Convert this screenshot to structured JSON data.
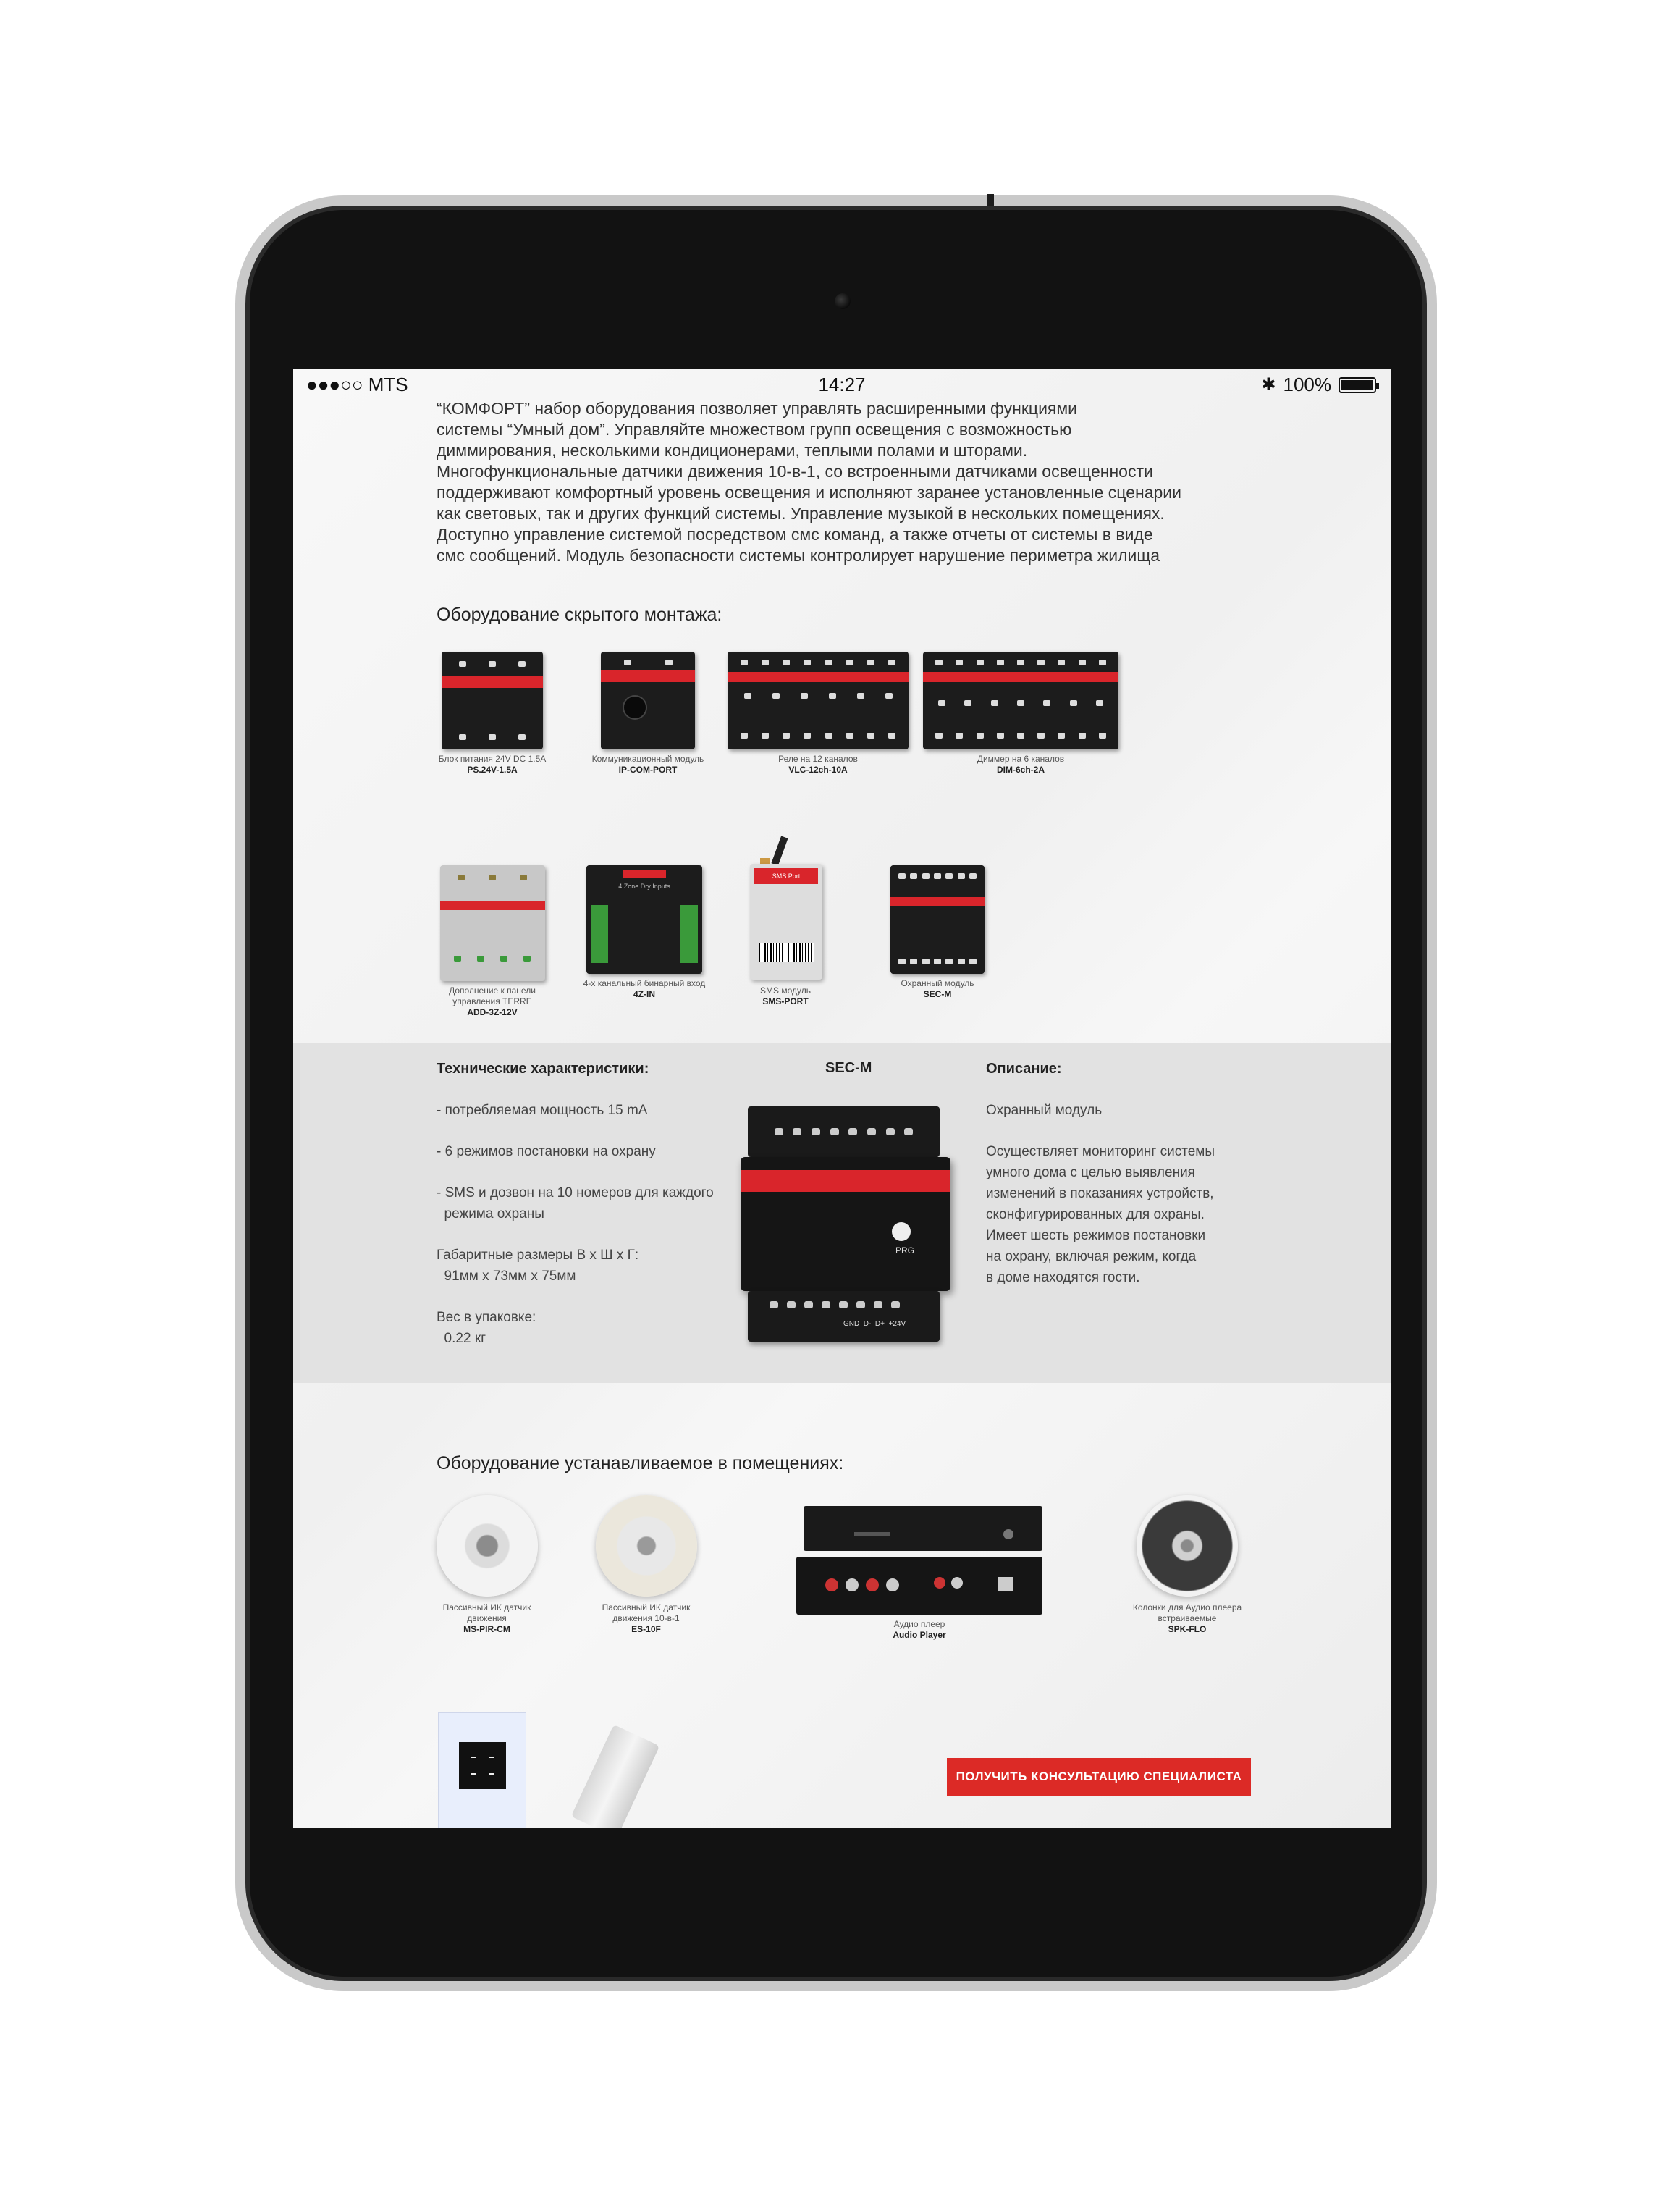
{
  "status_bar": {
    "carrier": "●●●○○ MTS",
    "time": "14:27",
    "battery": "100%"
  },
  "intro_lines": [
    "“КОМФОРТ” набор оборудования позволяет управлять расширенными функциями",
    "системы “Умный дом”. Управляйте множеством групп освещения с возможностью",
    "диммирования, несколькими кондиционерами, теплыми полами и шторами.",
    "Многофункциональные датчики движения 10-в-1, со встроенными датчиками освещенности",
    "поддерживают комфортный уровень освещения и исполняют заранее установленные сценарии",
    "как световых, так и других функций системы. Управление музыкой в нескольких помещениях.",
    "Доступно управление системой посредством смс команд, а также отчеты от системы в виде",
    "смс сообщений. Модуль безопасности системы контролирует нарушение периметра жилища"
  ],
  "hidden_section": {
    "title": "Оборудование скрытого монтажа:",
    "products": [
      {
        "desc": "Блок питания 24V DC 1.5A",
        "name": "PS.24V-1.5A"
      },
      {
        "desc": "Коммуникационный модуль",
        "name": "IP-COM-PORT"
      },
      {
        "desc": "Реле на 12 каналов",
        "name": "VLC-12ch-10A"
      },
      {
        "desc": "Диммер на 6 каналов",
        "name": "DIM-6ch-2A"
      },
      {
        "desc": "Дополнение к панели управления TERRE",
        "name": "ADD-3Z-12V"
      },
      {
        "desc": "4-х канальный бинарный вход",
        "name": "4Z-IN"
      },
      {
        "desc": "SMS модуль",
        "name": "SMS-PORT"
      },
      {
        "desc": "Охранный модуль",
        "name": "SEC-M"
      }
    ],
    "device_labels": {
      "zone_in": "4 Zone Dry Inputs",
      "sms": "SMS Port"
    }
  },
  "detail": {
    "specs_title": "Технические характеристики:",
    "specs": [
      "- потребляемая мощность 15 mA",
      "- 6 режимов постановки на охрану",
      "- SMS и дозвон на 10 номеров для каждого",
      "  режима охраны",
      "Габаритные размеры В х Ш х Г:",
      "  91мм х 73мм х 75мм",
      "Вес в упаковке:",
      "  0.22 кг"
    ],
    "product_title": "SEC-M",
    "device_prg": "PRG",
    "device_pins": "GND  D-  D+  +24V",
    "desc_title": "Описание:",
    "desc_lines": [
      "Охранный модуль",
      "",
      "Осуществляет мониторинг системы",
      "умного дома с целью выявления",
      "изменений в показаниях устройств,",
      "сконфигурированных для охраны.",
      "Имеет шесть режимов постановки",
      "на охрану, включая режим, когда",
      "в доме находятся гости."
    ]
  },
  "room_section": {
    "title": "Оборудование устанавливаемое в помещениях:",
    "products": [
      {
        "desc": "Пассивный ИК датчик движения",
        "name": "MS-PIR-CM"
      },
      {
        "desc": "Пассивный ИК датчик движения 10-в-1",
        "name": "ES-10F"
      },
      {
        "desc": "Аудио плеер",
        "name": "Audio Player"
      },
      {
        "desc": "Колонки для Аудио плеера встраиваемые",
        "name": "SPK-FLO"
      }
    ]
  },
  "cta_button": "ПОЛУЧИТЬ КОНСУЛЬТАЦИЮ СПЕЦИАЛИСТА"
}
